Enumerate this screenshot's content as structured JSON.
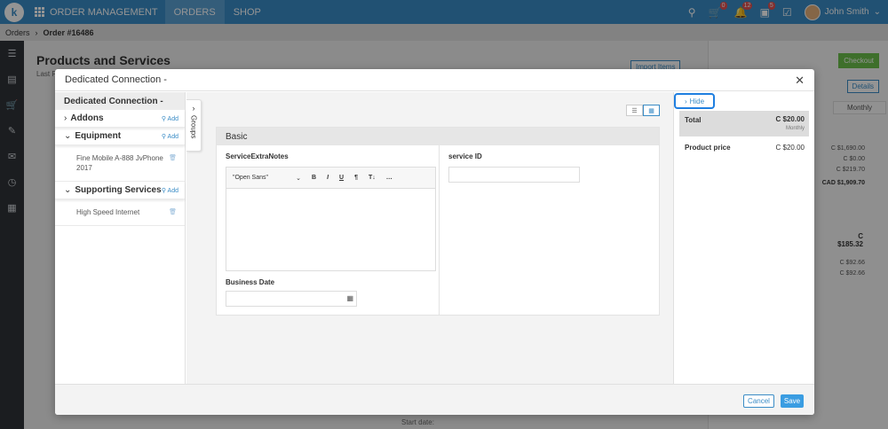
{
  "topbar": {
    "logo": "k",
    "app_title": "ORDER MANAGEMENT",
    "tabs": [
      {
        "label": "ORDERS"
      },
      {
        "label": "SHOP"
      }
    ],
    "badges": {
      "cart": "0",
      "bell": "12",
      "tasks": "5"
    },
    "user_name": "John Smith"
  },
  "breadcrumb": {
    "root": "Orders",
    "current": "Order #16486"
  },
  "background": {
    "title": "Products and Services",
    "subtitle": "Last P",
    "import_label": "Import Items",
    "checkout_label": "Checkout",
    "details_label": "Details",
    "monthly_label": "Monthly",
    "values_top": [
      "C $1,690.00",
      "C $0.00",
      "C $219.70",
      "CAD $1,909.70"
    ],
    "band_value": "C $185.32",
    "values_bottom": [
      "C $92.66",
      "C $92.66"
    ],
    "start_date_label": "Start date:"
  },
  "modal": {
    "title": "Dedicated Connection -",
    "left_title": "Dedicated Connection -",
    "groups_label": "Groups",
    "add_label": "Add",
    "groups": [
      {
        "label": "Addons",
        "items": []
      },
      {
        "label": "Equipment",
        "items": [
          "Fine Mobile A-888 JvPhone 2017"
        ]
      },
      {
        "label": "Supporting Services",
        "items": [
          "High Speed Internet"
        ]
      }
    ],
    "section_title": "Basic",
    "field_notes_label": "ServiceExtraNotes",
    "font_select": "\"Open Sans\"",
    "field_business_date_label": "Business Date",
    "field_service_id_label": "service ID",
    "hide_label": "Hide",
    "total_label": "Total",
    "total_value": "C $20.00",
    "total_period": "Monthly",
    "product_price_label": "Product price",
    "product_price_value": "C $20.00",
    "cancel_label": "Cancel",
    "save_label": "Save"
  }
}
